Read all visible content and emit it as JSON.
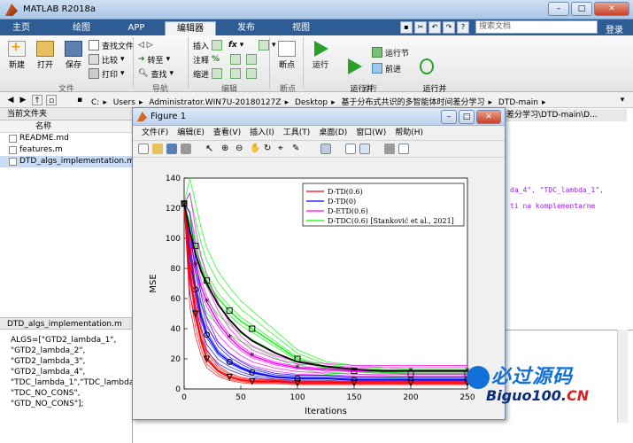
{
  "app": {
    "title": "MATLAB R2018a"
  },
  "tabs": [
    {
      "label": "主页"
    },
    {
      "label": "绘图"
    },
    {
      "label": "APP"
    },
    {
      "label": "编辑器"
    },
    {
      "label": "发布"
    },
    {
      "label": "视图"
    }
  ],
  "search": {
    "placeholder": "搜索文档"
  },
  "login_label": "登录",
  "toolbar": {
    "new": "新建",
    "open": "打开",
    "save": "保存",
    "find_files": "查找文件",
    "compare": "比较",
    "print": "打印",
    "insert": "插入",
    "fx": "fx",
    "comment": "注释",
    "indent": "缩进",
    "goto": "转至",
    "find": "查找",
    "breakpoint": "断点",
    "run": "运行",
    "run_advance": "运行并\n前进",
    "run_section": "运行节",
    "advance": "前进",
    "run_time": "运行并\n计时",
    "groups": {
      "file": "文件",
      "nav": "导航",
      "edit": "编辑",
      "bp": "断点",
      "run": "运行"
    }
  },
  "breadcrumbs": [
    "C:",
    "Users",
    "Administrator.WIN7U-20180127Z",
    "Desktop",
    "基于分布式共识的多智能体时间差分学习",
    "DTD-main"
  ],
  "left_panel": {
    "header": "当前文件夹",
    "col": "名称",
    "files": [
      "README.md",
      "features.m",
      "DTD_algs_implementation.m"
    ],
    "detail_header": "DTD_algs_implementation.m",
    "detail_text": "ALGS=[\"GTD2_lambda_1\",\n\"GTD2_lambda_2\",\n\"GTD2_lambda_3\",\n\"GTD2_lambda_4\",\n\"TDC_lambda_1\",\"TDC_lambda_2\n\"TDC_NO_CONS\",\n\"GTD_NO_CONS\"];"
  },
  "editor": {
    "header": "差分学习\\DTD-main\\D...",
    "code1": "da_4\", \"TDC_lambda_1\",",
    "code2": "ti na komplementarne"
  },
  "figure": {
    "title": "Figure 1",
    "menu": [
      "文件(F)",
      "编辑(E)",
      "查看(V)",
      "插入(I)",
      "工具(T)",
      "桌面(D)",
      "窗口(W)",
      "帮助(H)"
    ]
  },
  "chart_data": {
    "type": "line",
    "xlabel": "Iterations",
    "ylabel": "MSE",
    "xlim": [
      0,
      250
    ],
    "ylim": [
      0,
      140
    ],
    "xticks": [
      0,
      50,
      100,
      150,
      200,
      250
    ],
    "yticks": [
      0,
      20,
      40,
      60,
      80,
      100,
      120,
      140
    ],
    "legend_position": "top-right",
    "series": [
      {
        "name": "D-TD(0.6)",
        "color": "#ff0000",
        "marker": "triangle-down",
        "x": [
          0,
          5,
          10,
          15,
          20,
          30,
          40,
          50,
          60,
          80,
          100,
          125,
          150,
          175,
          200,
          225,
          250
        ],
        "y": [
          123,
          78,
          50,
          32,
          20,
          12,
          8,
          6,
          5,
          5,
          4,
          4,
          4,
          4,
          4,
          4,
          4
        ]
      },
      {
        "name": "D-TD(0)",
        "color": "#0000ff",
        "marker": "circle",
        "x": [
          0,
          5,
          10,
          15,
          20,
          30,
          40,
          50,
          60,
          80,
          100,
          125,
          150,
          175,
          200,
          225,
          250
        ],
        "y": [
          123,
          90,
          66,
          48,
          36,
          24,
          18,
          14,
          11,
          8,
          7,
          7,
          6,
          6,
          6,
          6,
          6
        ]
      },
      {
        "name": "D-ETD(0.6)",
        "color": "#ff00ff",
        "marker": "star",
        "x": [
          0,
          5,
          10,
          15,
          20,
          30,
          40,
          50,
          60,
          80,
          100,
          125,
          150,
          175,
          200,
          225,
          250
        ],
        "y": [
          123,
          100,
          82,
          68,
          58,
          44,
          34,
          27,
          22,
          17,
          14,
          13,
          12,
          12,
          12,
          12,
          12
        ]
      },
      {
        "name": "D-TDC(0.6) [Stanković et al., 2021]",
        "color": "#00ff00",
        "marker": "square",
        "x": [
          0,
          5,
          10,
          15,
          20,
          30,
          40,
          50,
          60,
          80,
          100,
          125,
          150,
          175,
          200,
          225,
          250
        ],
        "y": [
          123,
          110,
          95,
          82,
          72,
          60,
          52,
          45,
          40,
          30,
          20,
          14,
          12,
          11,
          10,
          10,
          10
        ]
      }
    ],
    "mean_curves": {
      "color": "#000000",
      "x": [
        0,
        5,
        10,
        15,
        20,
        30,
        40,
        50,
        60,
        80,
        100,
        125,
        150,
        175,
        200,
        225,
        250
      ],
      "tdc_mean": [
        123,
        105,
        90,
        78,
        70,
        56,
        46,
        38,
        32,
        24,
        18,
        15,
        13,
        12,
        12,
        12,
        12
      ]
    }
  },
  "watermark": {
    "cn": "必过源码",
    "en_a": "Biguo100.",
    "en_b": "CN"
  }
}
